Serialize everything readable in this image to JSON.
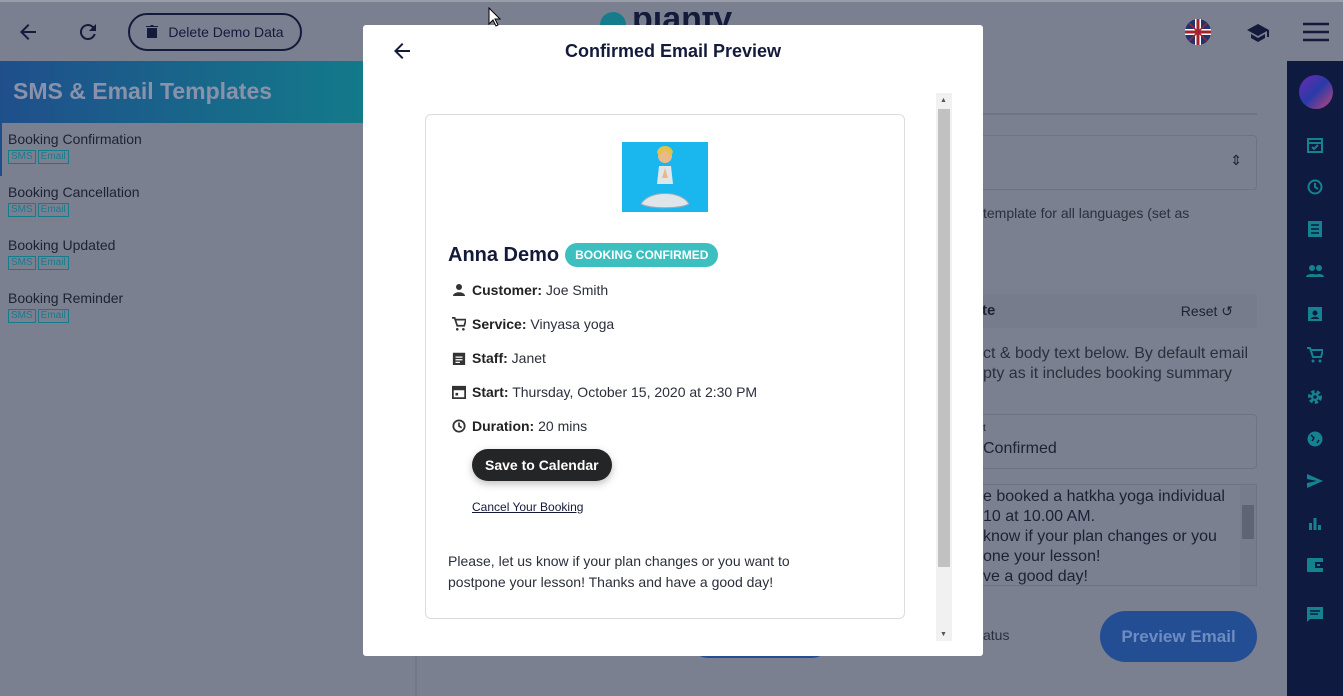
{
  "topbar": {
    "delete_label": "Delete Demo Data",
    "logo_text": "planfy"
  },
  "sidebar": {
    "title": "SMS & Email Templates",
    "items": [
      {
        "label": "Booking Confirmation",
        "tags": [
          "SMS",
          "Email"
        ]
      },
      {
        "label": "Booking Cancellation",
        "tags": [
          "SMS",
          "Email"
        ]
      },
      {
        "label": "Booking Updated",
        "tags": [
          "SMS",
          "Email"
        ]
      },
      {
        "label": "Booking Reminder",
        "tags": [
          "SMS",
          "Email"
        ]
      }
    ]
  },
  "background": {
    "lang_note": "template for all languages (set as",
    "section_title": "te",
    "reset": "Reset",
    "desc1": "ct & body text below. By default email",
    "desc2": "pty as it includes booking summary",
    "subject_label": "t",
    "subject_value": "Confirmed",
    "body_lines": [
      "e booked a hatkha yoga individual",
      "10 at 10.00 AM.",
      "know if your plan changes or you",
      "one your lesson!",
      "ve a good day!"
    ],
    "status": "atus",
    "preview_button": "Preview Email"
  },
  "modal": {
    "title": "Confirmed Email Preview",
    "name": "Anna Demo",
    "badge": "BOOKING CONFIRMED",
    "details": [
      {
        "label": "Customer:",
        "value": "Joe Smith",
        "icon": "person-icon"
      },
      {
        "label": "Service:",
        "value": "Vinyasa yoga",
        "icon": "cart-icon"
      },
      {
        "label": "Staff:",
        "value": "Janet",
        "icon": "clipboard-icon"
      },
      {
        "label": "Start:",
        "value": "Thursday, October 15, 2020 at 2:30 PM",
        "icon": "calendar-icon"
      },
      {
        "label": "Duration:",
        "value": "20 mins",
        "icon": "clock-icon"
      }
    ],
    "save_calendar": "Save to Calendar",
    "cancel_link": "Cancel Your Booking",
    "message": "Please, let us know if your plan changes or you want to postpone your lesson! Thanks and have a good day!"
  },
  "colors": {
    "accent": "#3dbfbf",
    "sidebar_dark": "#0e1a40",
    "overlay": "#7b8091"
  }
}
